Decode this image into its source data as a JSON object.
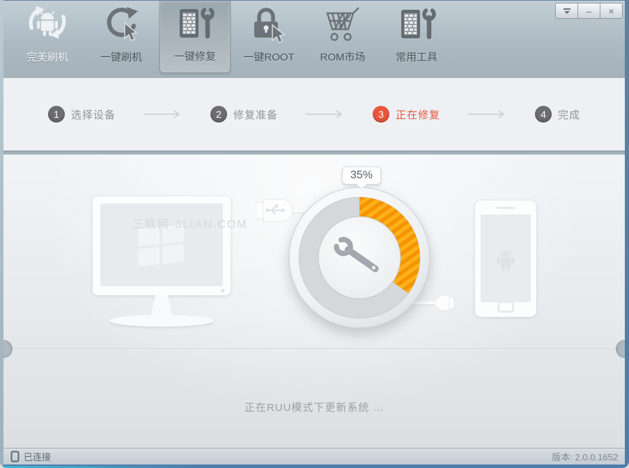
{
  "window": {
    "controls": {
      "minimize": "–",
      "close": "×"
    }
  },
  "toolbar": {
    "items": [
      {
        "label": "完美刷机"
      },
      {
        "label": "一键刷机"
      },
      {
        "label": "一键修复"
      },
      {
        "label": "一键ROOT"
      },
      {
        "label": "ROM市场"
      },
      {
        "label": "常用工具"
      }
    ],
    "active_index": 2
  },
  "steps": {
    "items": [
      {
        "num": "1",
        "label": "选择设备"
      },
      {
        "num": "2",
        "label": "修复准备"
      },
      {
        "num": "3",
        "label": "正在修复"
      },
      {
        "num": "4",
        "label": "完成"
      }
    ],
    "active_index": 2
  },
  "progress": {
    "percent": "35%",
    "status_text": "正在RUU模式下更新系统 ..."
  },
  "watermark": "三联网-3LIAN.COM",
  "statusbar": {
    "connection": "已连接",
    "version": "版本: 2.0.0.1652"
  },
  "colors": {
    "progress_orange": "#f59300",
    "progress_orange_light": "#fcb11c",
    "active_step_red": "#e8573d",
    "frame_blue": "#4d7dad"
  }
}
